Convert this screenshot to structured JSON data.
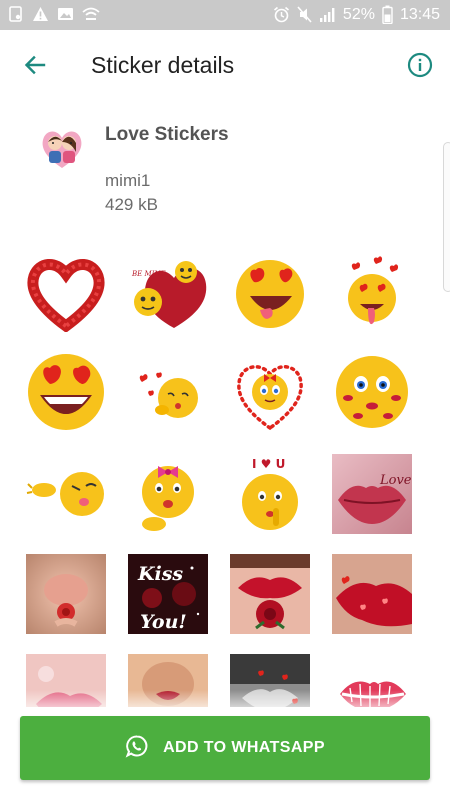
{
  "status_bar": {
    "battery_percent": "52%",
    "time": "13:45",
    "icons": [
      "sim-card-icon",
      "alert-icon",
      "image-icon",
      "wifi-icon",
      "alarm-icon",
      "mute-icon",
      "signal-icon",
      "battery-icon"
    ]
  },
  "app_bar": {
    "title": "Sticker details",
    "back_icon": "arrow-left-icon",
    "info_icon": "info-icon"
  },
  "pack": {
    "name": "Love Stickers",
    "author": "mimi1",
    "size": "429 kB"
  },
  "stickers": [
    "rose-heart-wreath",
    "be-mine-heart-smiley",
    "heart-eyes-tongue-smiley",
    "hearts-tongue-smiley",
    "heart-eyes-grin-smiley",
    "blowing-kiss-smiley",
    "heart-frame-blushing-smiley",
    "kiss-marks-smiley",
    "kissy-wave-smiley",
    "bow-kiss-smiley",
    "i-love-u-shush-smiley",
    "love-lips-photo",
    "lips-rose-photo",
    "kiss-you-photo",
    "red-lips-rose-photo",
    "lipstick-hearts-photo",
    "pink-lips-photo",
    "kiss-lips-photo",
    "lips-hearts-photo",
    "lip-print"
  ],
  "sticker_text": {
    "be_mine": "BE MINE",
    "i_love_u": "I ♥ U",
    "love": "Love",
    "kiss": "Kiss",
    "you": "You!"
  },
  "actions": {
    "add_label": "ADD TO WHATSAPP",
    "add_icon": "whatsapp-icon"
  },
  "colors": {
    "accent": "#1d8a80",
    "button": "#4caf3f",
    "status_bar": "#c9c9c9"
  }
}
